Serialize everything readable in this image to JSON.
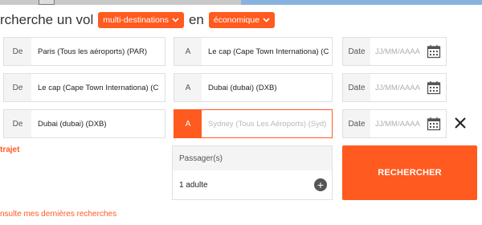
{
  "header": {
    "prefix": "rcherche un vol",
    "trip_type": "multi-destinations",
    "connector": "en",
    "cabin_class": "économique"
  },
  "legs": [
    {
      "from_label": "De",
      "from_value": "Paris (Tous les aéroports) (PAR)",
      "to_label": "A",
      "to_value": "Le cap (Cape Town Internationa) (C",
      "date_label": "Date",
      "date_placeholder": "JJ/MM/AAAA"
    },
    {
      "from_label": "De",
      "from_value": "Le cap (Cape Town Internationa) (C",
      "to_label": "A",
      "to_value": "Dubai (dubai) (DXB)",
      "date_label": "Date",
      "date_placeholder": "JJ/MM/AAAA"
    },
    {
      "from_label": "De",
      "from_value": "Dubai (dubai) (DXB)",
      "to_label": "A",
      "to_placeholder": "Sydney (Tous Les Aéroports) (Syd)",
      "date_label": "Date",
      "date_placeholder": "JJ/MM/AAAA"
    }
  ],
  "add_leg_link": "trajet",
  "passengers": {
    "label": "Passager(s)",
    "value": "1 adulte"
  },
  "search_button": "RECHERCHER",
  "recent_searches_link": "nsulte mes dernières recherches",
  "icons": {
    "calendar": "calendar-icon",
    "remove": "close-icon",
    "add": "plus-icon",
    "chevron": "chevron-down-icon"
  },
  "colors": {
    "accent": "#ff5a1f"
  }
}
